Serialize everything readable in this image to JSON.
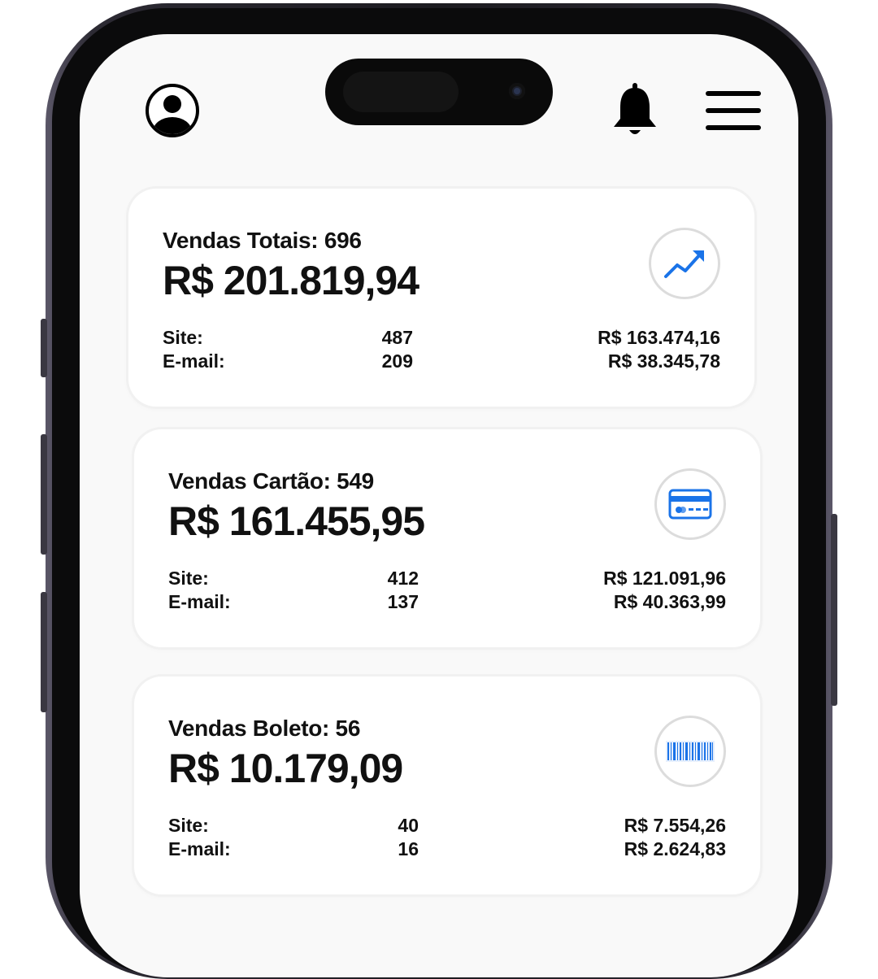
{
  "header": {
    "profile_icon": "user-circle-icon",
    "bell_icon": "bell-icon",
    "menu_icon": "hamburger-menu-icon"
  },
  "colors": {
    "accent": "#1a73e8",
    "text": "#111111",
    "card_bg": "#ffffff",
    "screen_bg": "#f9f9f9"
  },
  "cards": [
    {
      "title": "Vendas Totais: 696",
      "amount": "R$ 201.819,94",
      "icon": "trending-up-icon",
      "rows": [
        {
          "label": "Site:",
          "count": "487",
          "value": "R$ 163.474,16"
        },
        {
          "label": "E-mail:",
          "count": "209",
          "value": "R$ 38.345,78"
        }
      ]
    },
    {
      "title": "Vendas Cartão: 549",
      "amount": "R$ 161.455,95",
      "icon": "credit-card-icon",
      "rows": [
        {
          "label": "Site:",
          "count": "412",
          "value": "R$ 121.091,96"
        },
        {
          "label": "E-mail:",
          "count": "137",
          "value": "R$ 40.363,99"
        }
      ]
    },
    {
      "title": "Vendas Boleto: 56",
      "amount": "R$ 10.179,09",
      "icon": "barcode-icon",
      "rows": [
        {
          "label": "Site:",
          "count": "40",
          "value": "R$ 7.554,26"
        },
        {
          "label": "E-mail:",
          "count": "16",
          "value": "R$ 2.624,83"
        }
      ]
    }
  ]
}
